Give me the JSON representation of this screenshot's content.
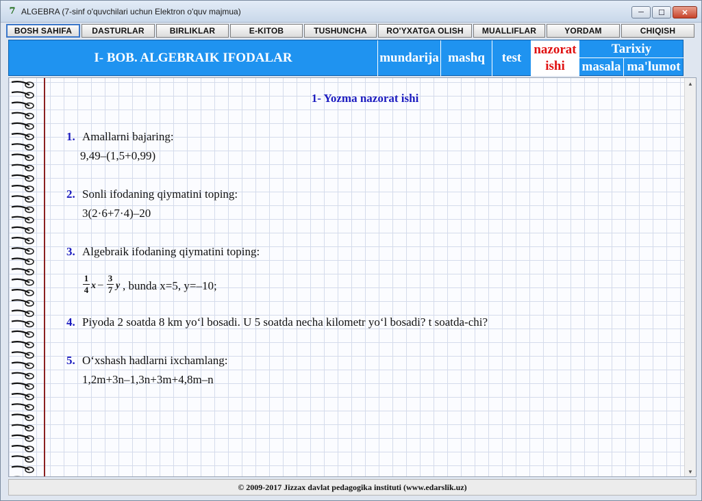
{
  "window": {
    "title": "ALGEBRA (7-sinf o'quvchilari uchun Elektron o'quv majmua)",
    "icon": "7",
    "minimize": "─",
    "maximize": "☐",
    "close": "✕"
  },
  "toolbar": {
    "buttons": [
      "BOSH SAHIFA",
      "DASTURLAR",
      "BIRLIKLAR",
      "E-KITOB",
      "TUSHUNCHA",
      "RO'YXATGA OLISH",
      "MUALLIFLAR",
      "YORDAM",
      "CHIQISH"
    ]
  },
  "header": {
    "title": "I- BOB. ALGEBRAIK IFODALAR",
    "mundarija": "mundarija",
    "mashq": "mashq",
    "test": "test",
    "nazorat_line1": "nazorat",
    "nazorat_line2": "ishi",
    "tarixiy": "Tarixiy",
    "masala": "masala",
    "malumot": "ma'lumot"
  },
  "document": {
    "title": "1- Yozma nazorat ishi",
    "q1": {
      "num": "1.",
      "text": "Amallarni bajaring:",
      "expr": "9,49–(1,5+0,99)"
    },
    "q2": {
      "num": "2.",
      "text": "Sonli ifodaning qiymatini toping:",
      "expr": "3(2·6+7·4)–20"
    },
    "q3": {
      "num": "3.",
      "text": "Algebraik ifodaning qiymatini toping:",
      "frac1_num": "1",
      "frac1_den": "4",
      "var1": "x",
      "minus": "–",
      "frac2_num": "3",
      "frac2_den": "7",
      "var2": "y",
      "rest": ",  bunda x=5,  y=–10;"
    },
    "q4": {
      "num": "4.",
      "text": "Piyoda 2 soatda 8 km yo‘l bosadi. U 5 soatda necha kilometr yo‘l bosadi?  t soatda-chi?"
    },
    "q5": {
      "num": "5.",
      "text": "O‘xshash hadlarni ixchamlang:",
      "expr": "1,2m+3n–1,3n+3m+4,8m–n"
    }
  },
  "footer": {
    "text": "© 2009-2017 Jizzax davlat pedagogika instituti    (www.edarslik.uz)"
  },
  "colors": {
    "header_blue": "#1f93f0",
    "accent_red": "#e01010",
    "question_blue": "#1b1bbf"
  }
}
